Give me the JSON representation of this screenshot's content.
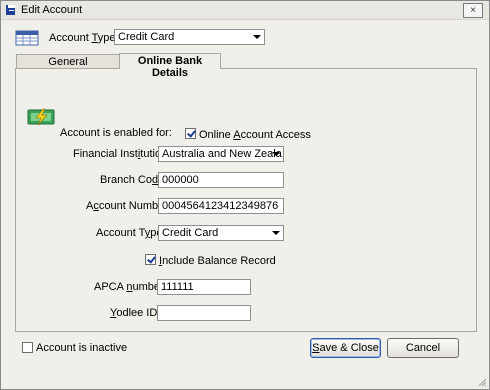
{
  "window": {
    "title": "Edit Account",
    "close_glyph": "×"
  },
  "header": {
    "account_type_label_pre": "Account ",
    "account_type_label_ul": "T",
    "account_type_label_post": "ype",
    "account_type_value": "Credit Card"
  },
  "tabs": [
    {
      "label": "General",
      "active": false
    },
    {
      "label": "Online Bank Details",
      "active": true
    }
  ],
  "form": {
    "enabled_label": "Account is enabled for:",
    "online_access_pre": "Online ",
    "online_access_ul": "A",
    "online_access_post": "ccount Access",
    "online_access_checked": true,
    "fin_inst_label_pre": "Financial Inst",
    "fin_inst_label_ul": "i",
    "fin_inst_label_post": "tution:",
    "fin_inst_value": "Australia and New Zeala...",
    "branch_label_pre": "Branch Co",
    "branch_label_ul": "d",
    "branch_label_post": "e:",
    "branch_value": "000000",
    "acctnum_label_pre": "A",
    "acctnum_label_ul": "c",
    "acctnum_label_post": "count Number:",
    "acctnum_value": "0004564123412349876",
    "accttype_label_pre": "Account T",
    "accttype_label_ul": "y",
    "accttype_label_post": "pe:",
    "accttype_value": "Credit Card",
    "balance_pre": "",
    "balance_ul": "I",
    "balance_post": "nclude Balance Record",
    "balance_checked": true,
    "apca_label_pre": "APCA ",
    "apca_label_ul": "n",
    "apca_label_post": "umber:",
    "apca_value": "111111",
    "yodlee_label_pre": "",
    "yodlee_label_ul": "Y",
    "yodlee_label_post": "odlee ID:",
    "yodlee_value": ""
  },
  "footer": {
    "inactive_label": "Account is inactive",
    "inactive_checked": false,
    "save_pre": "",
    "save_ul": "S",
    "save_post": "ave & Close",
    "cancel_label": "Cancel"
  },
  "colors": {
    "titlebar_icon": "#1f3f9a",
    "bank_icon_green": "#3aa35b",
    "bank_icon_yellow": "#f2d21a"
  },
  "icons": [
    "account-ledger-icon",
    "bank-money-icon",
    "checkmark-icon",
    "chevron-down-icon",
    "window-app-icon",
    "resize-grip-icon"
  ]
}
